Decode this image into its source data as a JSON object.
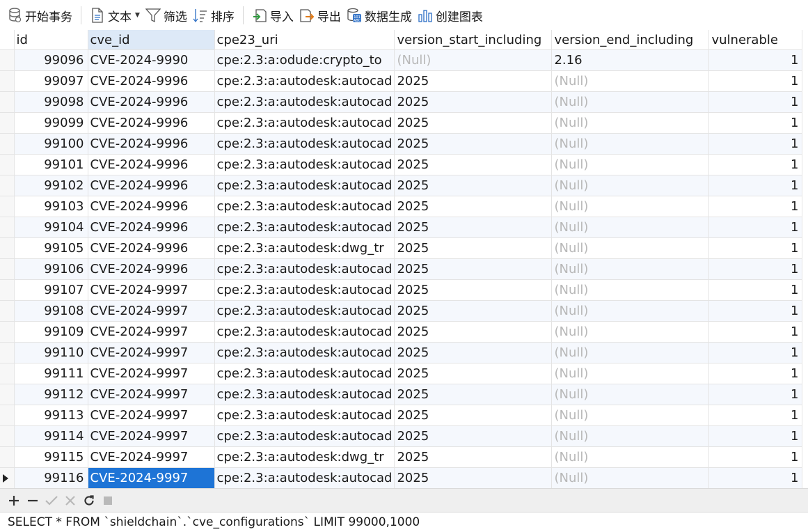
{
  "toolbar": {
    "begin_transaction": "开始事务",
    "text": "文本",
    "filter": "筛选",
    "sort": "排序",
    "import": "导入",
    "export": "导出",
    "data_generation": "数据生成",
    "create_chart": "创建图表"
  },
  "grid": {
    "columns": [
      "id",
      "cve_id",
      "cpe23_uri",
      "version_start_including",
      "version_end_including",
      "vulnerable"
    ],
    "selected_column": "cve_id",
    "rows": [
      {
        "id": "99096",
        "cve_id": "CVE-2024-9990",
        "cpe23_uri": "cpe:2.3:a:odude:crypto_to",
        "version_start_including": "(Null)",
        "version_end_including": "2.16",
        "vulnerable": "1"
      },
      {
        "id": "99097",
        "cve_id": "CVE-2024-9996",
        "cpe23_uri": "cpe:2.3:a:autodesk:autocad",
        "version_start_including": "2025",
        "version_end_including": "(Null)",
        "vulnerable": "1"
      },
      {
        "id": "99098",
        "cve_id": "CVE-2024-9996",
        "cpe23_uri": "cpe:2.3:a:autodesk:autocad",
        "version_start_including": "2025",
        "version_end_including": "(Null)",
        "vulnerable": "1"
      },
      {
        "id": "99099",
        "cve_id": "CVE-2024-9996",
        "cpe23_uri": "cpe:2.3:a:autodesk:autocad",
        "version_start_including": "2025",
        "version_end_including": "(Null)",
        "vulnerable": "1"
      },
      {
        "id": "99100",
        "cve_id": "CVE-2024-9996",
        "cpe23_uri": "cpe:2.3:a:autodesk:autocad",
        "version_start_including": "2025",
        "version_end_including": "(Null)",
        "vulnerable": "1"
      },
      {
        "id": "99101",
        "cve_id": "CVE-2024-9996",
        "cpe23_uri": "cpe:2.3:a:autodesk:autocad",
        "version_start_including": "2025",
        "version_end_including": "(Null)",
        "vulnerable": "1"
      },
      {
        "id": "99102",
        "cve_id": "CVE-2024-9996",
        "cpe23_uri": "cpe:2.3:a:autodesk:autocad",
        "version_start_including": "2025",
        "version_end_including": "(Null)",
        "vulnerable": "1"
      },
      {
        "id": "99103",
        "cve_id": "CVE-2024-9996",
        "cpe23_uri": "cpe:2.3:a:autodesk:autocad",
        "version_start_including": "2025",
        "version_end_including": "(Null)",
        "vulnerable": "1"
      },
      {
        "id": "99104",
        "cve_id": "CVE-2024-9996",
        "cpe23_uri": "cpe:2.3:a:autodesk:autocad",
        "version_start_including": "2025",
        "version_end_including": "(Null)",
        "vulnerable": "1"
      },
      {
        "id": "99105",
        "cve_id": "CVE-2024-9996",
        "cpe23_uri": "cpe:2.3:a:autodesk:dwg_tr",
        "version_start_including": "2025",
        "version_end_including": "(Null)",
        "vulnerable": "1"
      },
      {
        "id": "99106",
        "cve_id": "CVE-2024-9996",
        "cpe23_uri": "cpe:2.3:a:autodesk:autocad",
        "version_start_including": "2025",
        "version_end_including": "(Null)",
        "vulnerable": "1"
      },
      {
        "id": "99107",
        "cve_id": "CVE-2024-9997",
        "cpe23_uri": "cpe:2.3:a:autodesk:autocad",
        "version_start_including": "2025",
        "version_end_including": "(Null)",
        "vulnerable": "1"
      },
      {
        "id": "99108",
        "cve_id": "CVE-2024-9997",
        "cpe23_uri": "cpe:2.3:a:autodesk:autocad",
        "version_start_including": "2025",
        "version_end_including": "(Null)",
        "vulnerable": "1"
      },
      {
        "id": "99109",
        "cve_id": "CVE-2024-9997",
        "cpe23_uri": "cpe:2.3:a:autodesk:autocad",
        "version_start_including": "2025",
        "version_end_including": "(Null)",
        "vulnerable": "1"
      },
      {
        "id": "99110",
        "cve_id": "CVE-2024-9997",
        "cpe23_uri": "cpe:2.3:a:autodesk:autocad",
        "version_start_including": "2025",
        "version_end_including": "(Null)",
        "vulnerable": "1"
      },
      {
        "id": "99111",
        "cve_id": "CVE-2024-9997",
        "cpe23_uri": "cpe:2.3:a:autodesk:autocad",
        "version_start_including": "2025",
        "version_end_including": "(Null)",
        "vulnerable": "1"
      },
      {
        "id": "99112",
        "cve_id": "CVE-2024-9997",
        "cpe23_uri": "cpe:2.3:a:autodesk:autocad",
        "version_start_including": "2025",
        "version_end_including": "(Null)",
        "vulnerable": "1"
      },
      {
        "id": "99113",
        "cve_id": "CVE-2024-9997",
        "cpe23_uri": "cpe:2.3:a:autodesk:autocad",
        "version_start_including": "2025",
        "version_end_including": "(Null)",
        "vulnerable": "1"
      },
      {
        "id": "99114",
        "cve_id": "CVE-2024-9997",
        "cpe23_uri": "cpe:2.3:a:autodesk:autocad",
        "version_start_including": "2025",
        "version_end_including": "(Null)",
        "vulnerable": "1"
      },
      {
        "id": "99115",
        "cve_id": "CVE-2024-9997",
        "cpe23_uri": "cpe:2.3:a:autodesk:dwg_tr",
        "version_start_including": "2025",
        "version_end_including": "(Null)",
        "vulnerable": "1"
      },
      {
        "id": "99116",
        "cve_id": "CVE-2024-9997",
        "cpe23_uri": "cpe:2.3:a:autodesk:autocad",
        "version_start_including": "2025",
        "version_end_including": "(Null)",
        "vulnerable": "1"
      }
    ],
    "current_row_index": 20
  },
  "bottombar": {
    "icons": [
      "add-record-icon",
      "delete-record-icon",
      "apply-changes-icon",
      "discard-changes-icon",
      "refresh-icon",
      "stop-icon"
    ]
  },
  "status": {
    "sql": "SELECT * FROM `shieldchain`.`cve_configurations` LIMIT 99000,1000"
  },
  "colors": {
    "selection": "#1e74d6",
    "column_highlight": "#dde9f7",
    "alt_row": "#f5f8fd",
    "null_text": "#b8b8b8"
  }
}
